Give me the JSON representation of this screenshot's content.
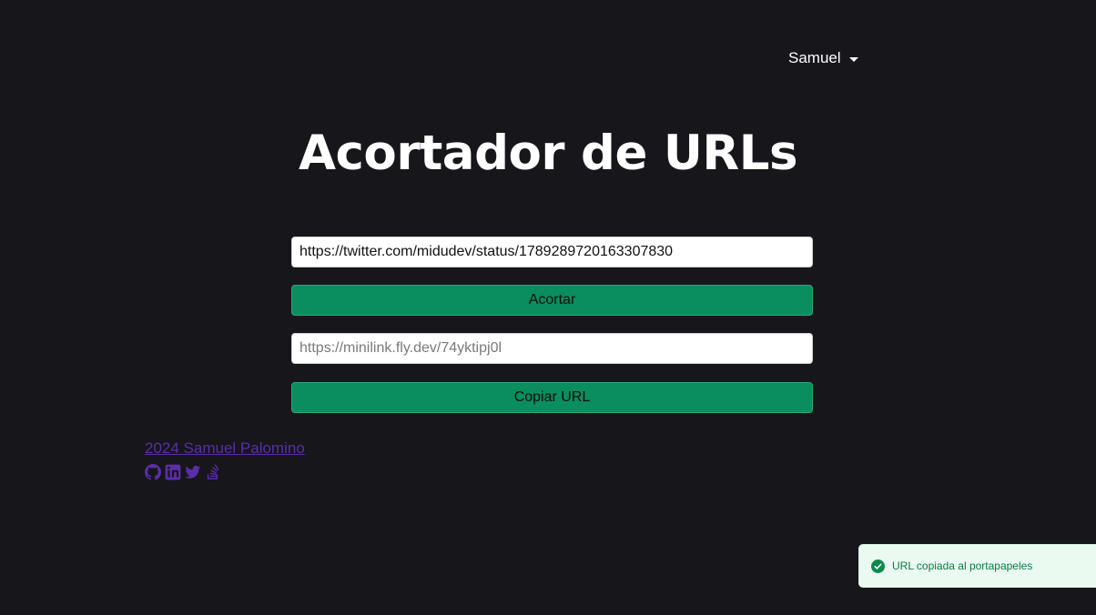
{
  "header": {
    "user_name": "Samuel"
  },
  "main": {
    "title": "Acortador de URLs",
    "long_url_value": "https://twitter.com/midudev/status/1789289720163307830",
    "shorten_button_label": "Acortar",
    "short_url_placeholder": "https://minilink.fly.dev/74yktipj0l",
    "copy_button_label": "Copiar URL"
  },
  "footer": {
    "credit_text": "2024 Samuel Palomino",
    "social_icons": [
      "github-icon",
      "linkedin-icon",
      "twitter-icon",
      "stackoverflow-icon"
    ],
    "link_color": "#5a2ea8"
  },
  "toast": {
    "message": "URL copiada al portapapeles",
    "icon": "check-circle-icon",
    "color": "#0b7a44"
  },
  "colors": {
    "background": "#16161b",
    "button": "#0a8d5f"
  }
}
